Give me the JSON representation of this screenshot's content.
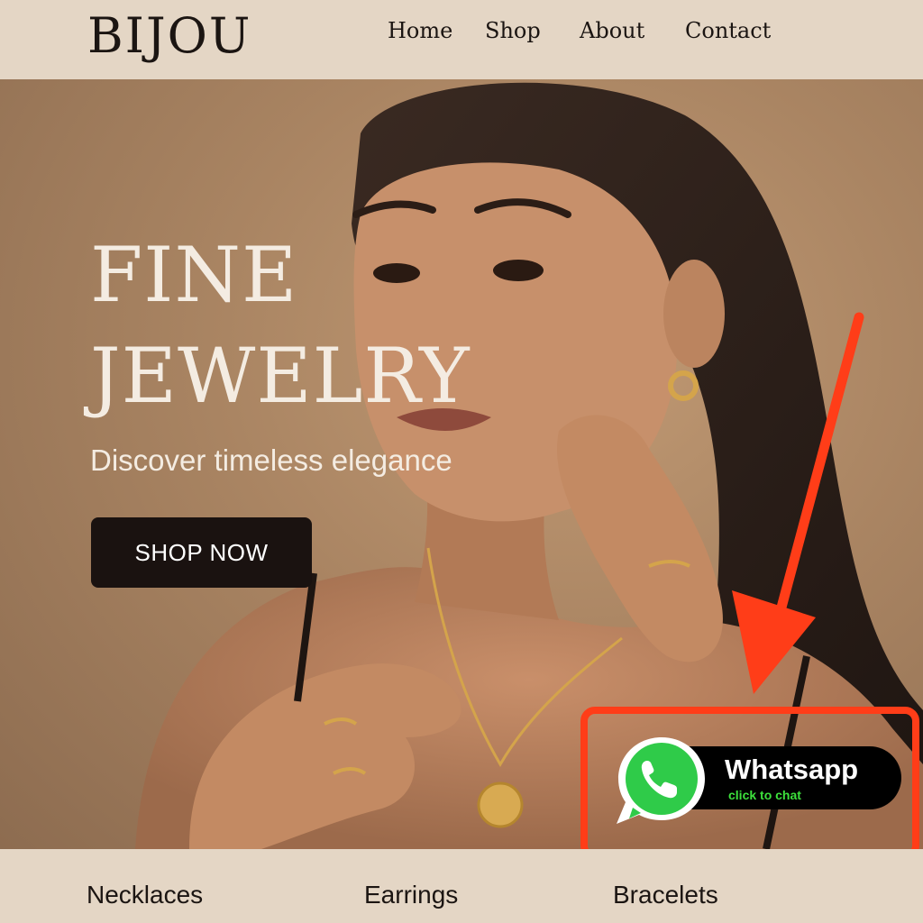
{
  "brand": "BIJOU",
  "nav": [
    "Home",
    "Shop",
    "About",
    "Contact"
  ],
  "hero": {
    "title_line1": "FINE",
    "title_line2": "JEWELRY",
    "subtitle": "Discover timeless elegance",
    "cta": "SHOP NOW"
  },
  "whatsapp": {
    "label": "Whatsapp",
    "sub": "click to chat"
  },
  "categories": [
    "Necklaces",
    "Earrings",
    "Bracelets"
  ],
  "colors": {
    "header_bg": "#e4d6c5",
    "hero_bg": "#a98462",
    "button_bg": "#1a1210",
    "highlight": "#ff3d18",
    "whatsapp_green": "#2fcb49",
    "whatsapp_sub": "#3de13c"
  },
  "icons": [
    "whatsapp-icon",
    "phone-icon",
    "arrow-icon"
  ]
}
